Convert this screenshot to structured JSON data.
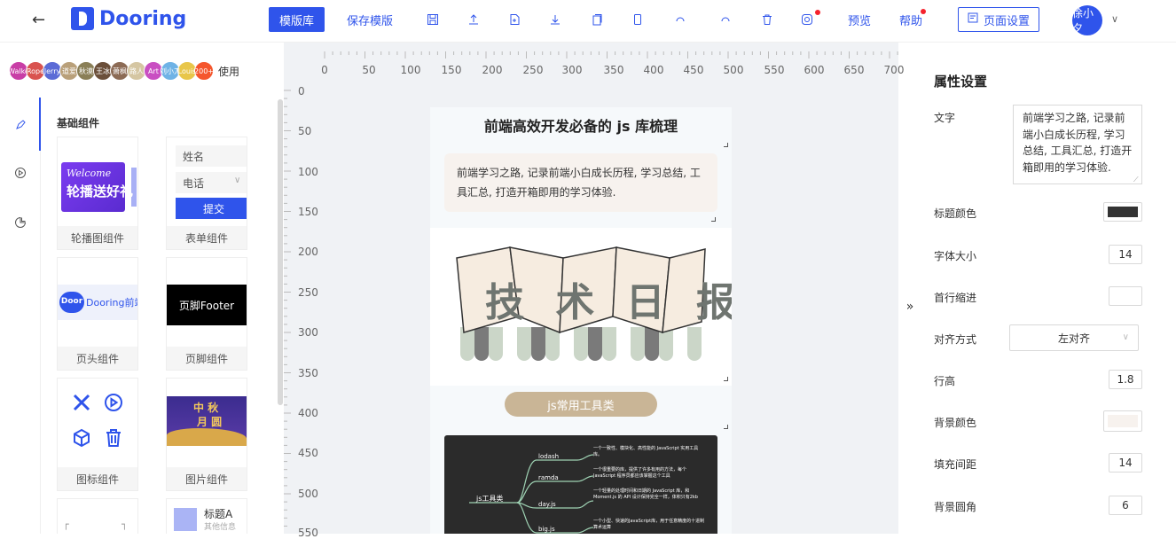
{
  "header": {
    "brand": "Dooring",
    "template_lib": "模版库",
    "save_template": "保存模版",
    "preview": "预览",
    "help": "帮助",
    "page_settings": "页面设置",
    "user": "徐小夕",
    "colors": {
      "primary": "#2f54eb",
      "notify": "#f5222d"
    }
  },
  "avatars": {
    "items": [
      "Walke",
      "Rope",
      "Jerry",
      "道爱",
      "秋漠",
      "王冰",
      "萧枫",
      "路人",
      "Art",
      "刘小刀",
      "Louis",
      "200+"
    ],
    "use_label": "使用"
  },
  "sidebar": {
    "section_title": "基础组件",
    "cards": [
      {
        "label": "轮播图组件",
        "banner_en": "Welcome",
        "banner_cn": "轮播送好礼"
      },
      {
        "label": "表单组件",
        "field_name": "姓名",
        "field_phone": "电话",
        "submit": "提交"
      },
      {
        "label": "页头组件",
        "logo_text": "Door",
        "header_text": "Dooring前端"
      },
      {
        "label": "页脚组件",
        "footer_text": "页脚Footer"
      },
      {
        "label": "图标组件"
      },
      {
        "label": "图片组件",
        "image_text_1": "中 秋",
        "image_text_2": "月 圆"
      },
      {
        "label": "",
        "title": "标题A",
        "sub": "其他信息"
      }
    ]
  },
  "rulers": {
    "top": [
      "0",
      "50",
      "100",
      "150",
      "200",
      "250",
      "300",
      "350",
      "400",
      "450",
      "500",
      "550",
      "600",
      "650",
      "700"
    ],
    "left": [
      "0",
      "50",
      "100",
      "150",
      "200",
      "250",
      "300",
      "350",
      "400",
      "450",
      "500",
      "550"
    ]
  },
  "phone": {
    "title": "前端高效开发必备的 js 库梳理",
    "text": "前端学习之路, 记录前端小白成长历程, 学习总结, 工具汇总, 打造开箱即用的学习体验.",
    "banner_text": "技 术 日 报",
    "tag": "js常用工具类",
    "mindmap": {
      "root": "js工具类",
      "nodes": [
        {
          "name": "lodash",
          "desc": "一个一致性、模块化、高性能的 JavaScript 实用工具库。"
        },
        {
          "name": "ramda",
          "desc": "一个很重要的库，提供了许多有用的方法，每个 JavaScript 程序员都应该掌握这个工具"
        },
        {
          "name": "day.js",
          "desc": "一个轻量的处理时间和日期的 JavaScript 库，和 Moment.js 的 API 设计保持完全一样，体积只有2kb"
        },
        {
          "name": "big.js",
          "desc": "一个小型、快速的JavaScript库，用于任意精度的十进制算术运算"
        }
      ]
    }
  },
  "collapse_icon": "»",
  "props": {
    "title": "属性设置",
    "text_label": "文字",
    "text_value": "前端学习之路, 记录前端小白成长历程, 学习总结, 工具汇总, 打造开箱即用的学习体验.",
    "title_color_label": "标题颜色",
    "title_color": "#333333",
    "font_size_label": "字体大小",
    "font_size": "14",
    "indent_label": "首行缩进",
    "indent": "",
    "align_label": "对齐方式",
    "align": "左对齐",
    "line_height_label": "行高",
    "line_height": "1.8",
    "bg_color_label": "背景颜色",
    "bg_color": "#f7f2ee",
    "padding_label": "填充间距",
    "padding": "14",
    "radius_label": "背景圆角",
    "radius": "6"
  }
}
